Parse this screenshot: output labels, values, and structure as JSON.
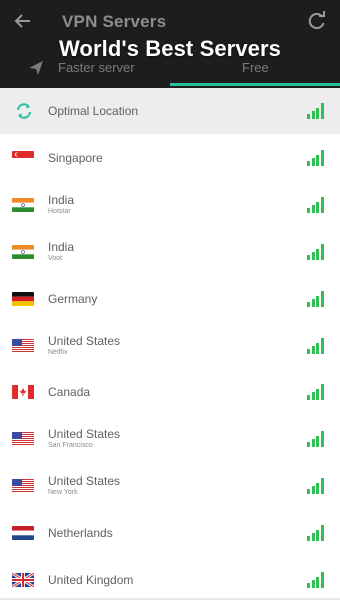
{
  "header": {
    "app_title": "VPN Servers",
    "overlay_title": "World's Best Servers",
    "back_icon": "arrow-left-icon",
    "refresh_icon": "refresh-icon",
    "tabs": [
      {
        "label": "Faster server",
        "icon": "send-icon",
        "selected": false
      },
      {
        "label": "Free",
        "selected": true
      }
    ],
    "accent_color": "#2bbf9f"
  },
  "servers": [
    {
      "name": "Optimal Location",
      "sub": "",
      "flag": "optimal",
      "selected": true
    },
    {
      "name": "Singapore",
      "sub": "",
      "flag": "sg"
    },
    {
      "name": "India",
      "sub": "Hotstar",
      "flag": "in"
    },
    {
      "name": "India",
      "sub": "Voot",
      "flag": "in"
    },
    {
      "name": "Germany",
      "sub": "",
      "flag": "de"
    },
    {
      "name": "United States",
      "sub": "Netflix",
      "flag": "us"
    },
    {
      "name": "Canada",
      "sub": "",
      "flag": "ca"
    },
    {
      "name": "United States",
      "sub": "San Francisco",
      "flag": "us"
    },
    {
      "name": "United States",
      "sub": "New York",
      "flag": "us"
    },
    {
      "name": "Netherlands",
      "sub": "",
      "flag": "nl"
    },
    {
      "name": "United Kingdom",
      "sub": "",
      "flag": "uk"
    }
  ],
  "signal_color": "#2fbf55"
}
